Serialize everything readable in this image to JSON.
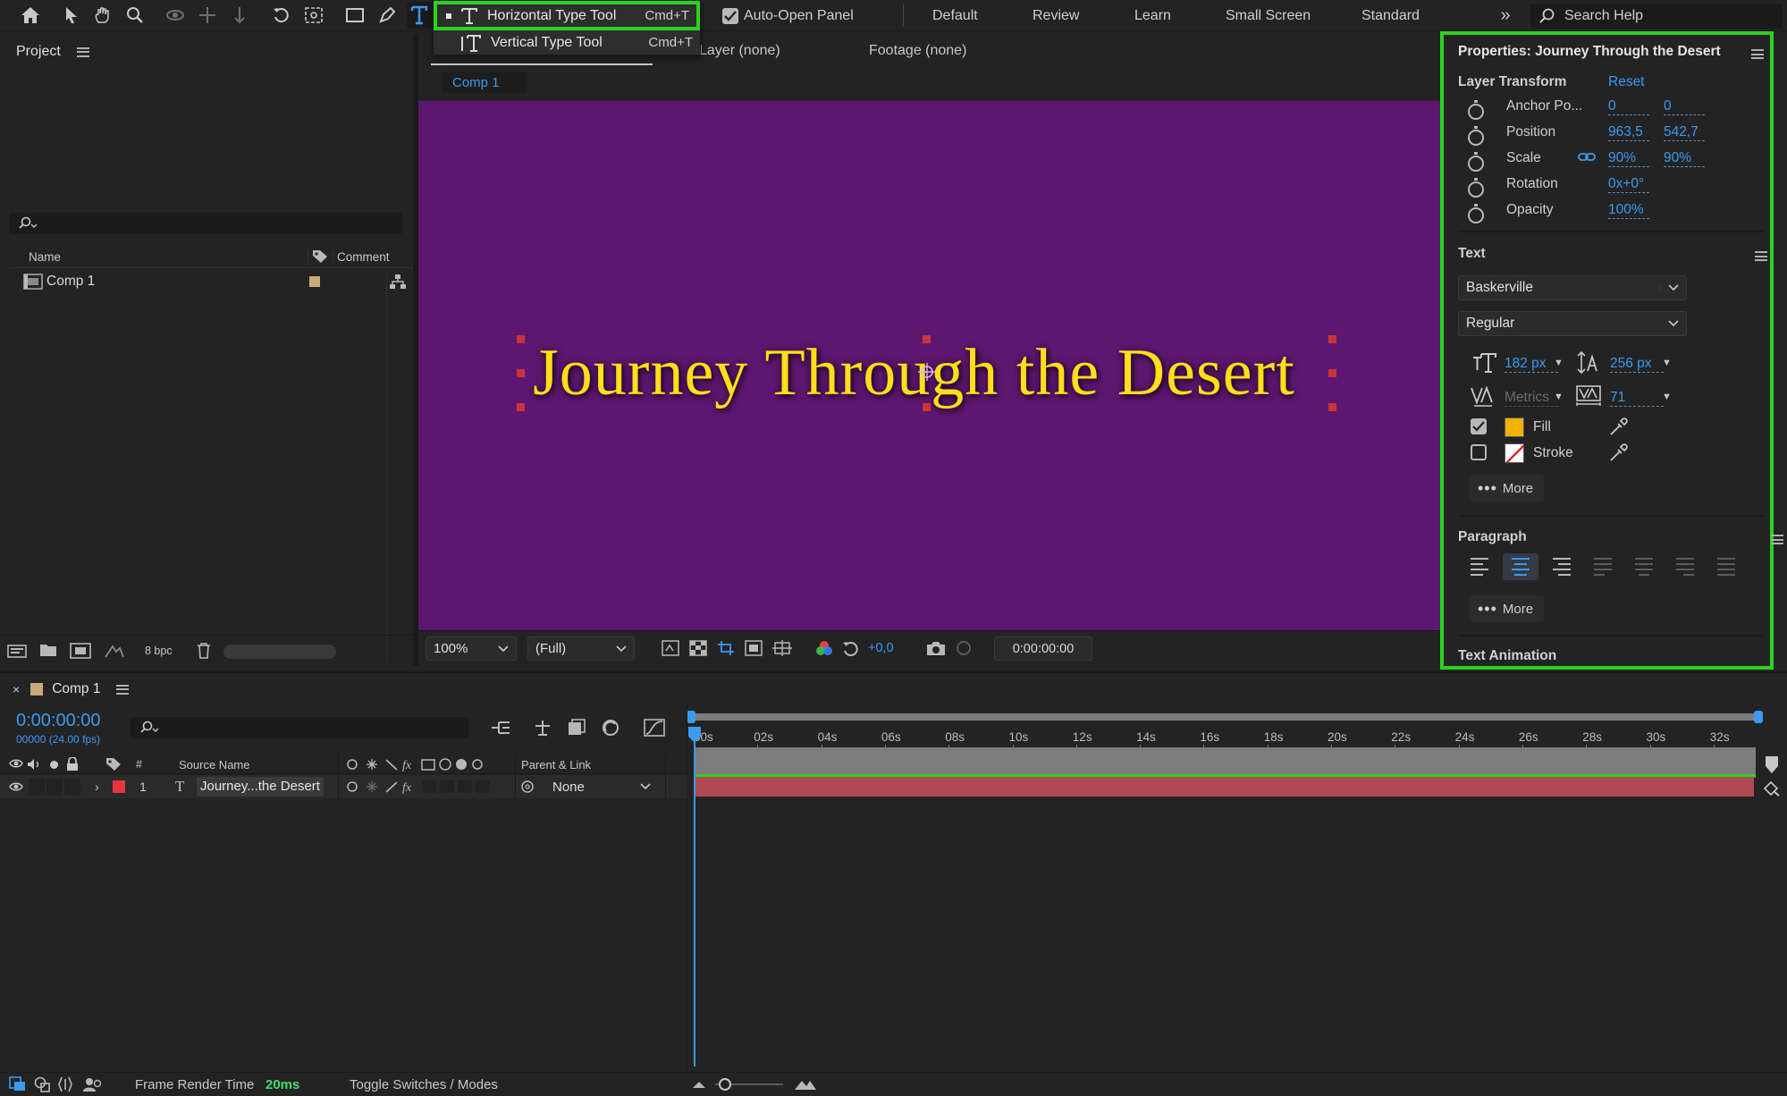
{
  "toolbar": {
    "auto_open_label": "Auto-Open Panel",
    "workspaces": [
      "Default",
      "Review",
      "Learn",
      "Small Screen",
      "Standard"
    ],
    "search_help": "Search Help"
  },
  "type_menu": {
    "items": [
      {
        "label": "Horizontal Type Tool",
        "shortcut": "Cmd+T"
      },
      {
        "label": "Vertical Type Tool",
        "shortcut": "Cmd+T"
      }
    ]
  },
  "project": {
    "title": "Project",
    "col_name": "Name",
    "col_comment": "Comment",
    "item_name": "Comp 1",
    "bpc": "8 bpc"
  },
  "viewer": {
    "tab_layer": "Layer (none)",
    "tab_footage": "Footage (none)",
    "comp_tab": "Comp 1",
    "title_text": "Journey Through the Desert",
    "bg_color": "#5e1770",
    "text_color": "#ffde1a",
    "zoom": "100%",
    "resolution": "(Full)",
    "exposure": "+0,0",
    "timecode": "0:00:00:00"
  },
  "properties": {
    "title": "Properties: Journey Through the Desert",
    "layer_transform": "Layer Transform",
    "reset": "Reset",
    "rows": [
      {
        "label": "Anchor Po...",
        "v1": "0",
        "v2": "0"
      },
      {
        "label": "Position",
        "v1": "963,5",
        "v2": "542,7"
      },
      {
        "label": "Scale",
        "v1": "90%",
        "v2": "90%"
      },
      {
        "label": "Rotation",
        "v1": "0x+0°",
        "v2": ""
      },
      {
        "label": "Opacity",
        "v1": "100%",
        "v2": ""
      }
    ],
    "text_section": "Text",
    "font": "Baskerville",
    "style": "Regular",
    "font_size": "182 px",
    "leading": "256 px",
    "kerning": "Metrics",
    "tracking": "71",
    "fill_label": "Fill",
    "stroke_label": "Stroke",
    "fill_color": "#f0b400",
    "more1": "More",
    "paragraph": "Paragraph",
    "more2": "More",
    "text_animation": "Text Animation"
  },
  "timeline": {
    "comp_tab": "Comp 1",
    "timecode": "0:00:00:00",
    "frames": "00000 (24.00 fps)",
    "col_num": "#",
    "col_source": "Source Name",
    "col_parent": "Parent & Link",
    "layer_index": "1",
    "layer_name": "Journey...the Desert",
    "parent_value": "None",
    "ticks": [
      "00s",
      "02s",
      "04s",
      "06s",
      "08s",
      "10s",
      "12s",
      "14s",
      "16s",
      "18s",
      "20s",
      "22s",
      "24s",
      "26s",
      "28s",
      "30s",
      "32s"
    ]
  },
  "status": {
    "frame_render_label": "Frame Render Time",
    "frame_render_value": "20ms",
    "toggle": "Toggle Switches / Modes"
  }
}
